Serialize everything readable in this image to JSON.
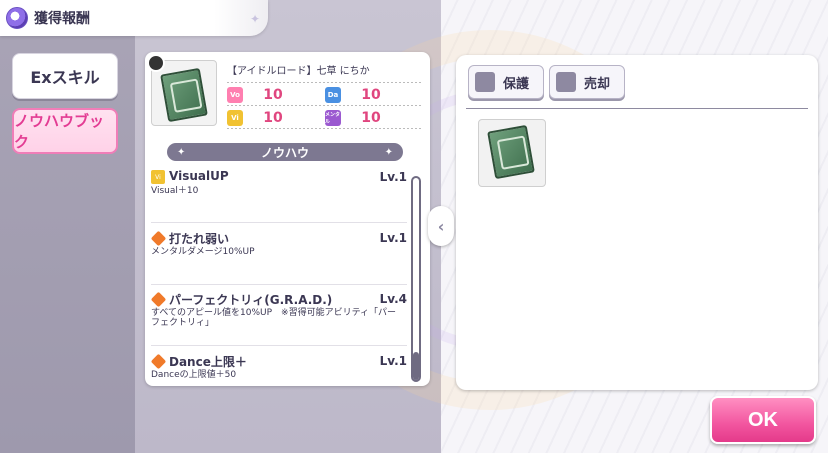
{
  "header": {
    "title": "獲得報酬"
  },
  "tabs": [
    {
      "label": "Exスキル"
    },
    {
      "label": "ノウハウブック"
    }
  ],
  "item": {
    "name": "【アイドルロード】七草 にちか",
    "stats": [
      {
        "icon": "Vo",
        "value": "10",
        "color": "#ff7fb0"
      },
      {
        "icon": "Da",
        "value": "10",
        "color": "#4a90e2"
      },
      {
        "icon": "Vi",
        "value": "10",
        "color": "#f1c232"
      },
      {
        "icon": "メンタル",
        "value": "10",
        "color": "#9b59d0"
      }
    ]
  },
  "knowhow": {
    "header": "ノウハウ",
    "skills": [
      {
        "name": "VisualUP",
        "level": "Lv.1",
        "desc": "Visual＋10",
        "icon": "visual-icon"
      },
      {
        "name": "打たれ弱い",
        "level": "Lv.1",
        "desc": "メンタルダメージ10%UP",
        "icon": "orange-diamond-icon"
      },
      {
        "name": "パーフェクトリィ(G.R.A.D.)",
        "level": "Lv.4",
        "desc": "すべてのアピール値を10%UP　※習得可能アビリティ「パーフェクトリィ」",
        "icon": "orange-diamond-icon"
      },
      {
        "name": "Dance上限＋",
        "level": "Lv.1",
        "desc": "Danceの上限値＋50",
        "icon": "orange-diamond-icon"
      }
    ]
  },
  "right_panel": {
    "protect_label": "保護",
    "sell_label": "売却"
  },
  "ok_label": "OK"
}
